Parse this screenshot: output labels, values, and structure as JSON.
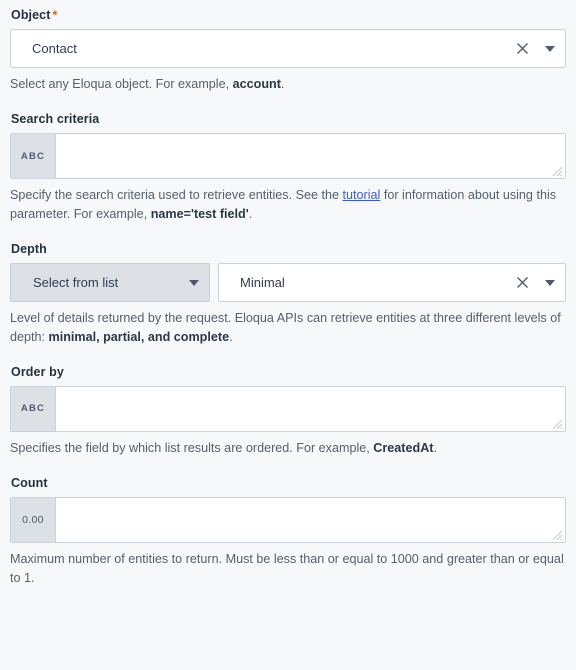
{
  "fields": {
    "object": {
      "label": "Object",
      "required_marker": "*",
      "value": "Contact",
      "clear_icon": "close-icon",
      "caret_icon": "chevron-down-icon",
      "helper": {
        "pre": "Select any Eloqua object. For example, ",
        "bold": "account",
        "post": "."
      }
    },
    "search_criteria": {
      "label": "Search criteria",
      "prefix": "ABC",
      "value": "",
      "placeholder": "",
      "helper": {
        "pre": "Specify the search criteria used to retrieve entities. See the ",
        "link": "tutorial",
        "mid": " for information about using this parameter. For example, ",
        "bold": "name='test field'",
        "post": "."
      }
    },
    "depth": {
      "label": "Depth",
      "list_button_label": "Select from list",
      "list_button_caret": "chevron-down-icon",
      "value": "Minimal",
      "clear_icon": "close-icon",
      "caret_icon": "chevron-down-icon",
      "helper": {
        "pre": "Level of details returned by the request. Eloqua APIs can retrieve entities at three different levels of depth: ",
        "bold": "minimal, partial, and complete",
        "post": "."
      }
    },
    "order_by": {
      "label": "Order by",
      "prefix": "ABC",
      "value": "",
      "placeholder": "",
      "helper": {
        "pre": "Specifies the field by which list results are ordered. For example, ",
        "bold": "CreatedAt",
        "post": "."
      }
    },
    "count": {
      "label": "Count",
      "prefix": "0.00",
      "value": "",
      "placeholder": "",
      "helper": {
        "pre": "Maximum number of entities to return. Must be less than or equal to 1000 and greater than or equal to 1.",
        "bold": "",
        "post": ""
      }
    }
  },
  "colors": {
    "page_background": "#f7f8f9",
    "field_border": "#ccd2d9",
    "prefix_background": "#dde1e6",
    "label_text": "#243142",
    "helper_text": "#55606e",
    "link": "#3b5bdb",
    "required_asterisk": "#e8590c"
  }
}
